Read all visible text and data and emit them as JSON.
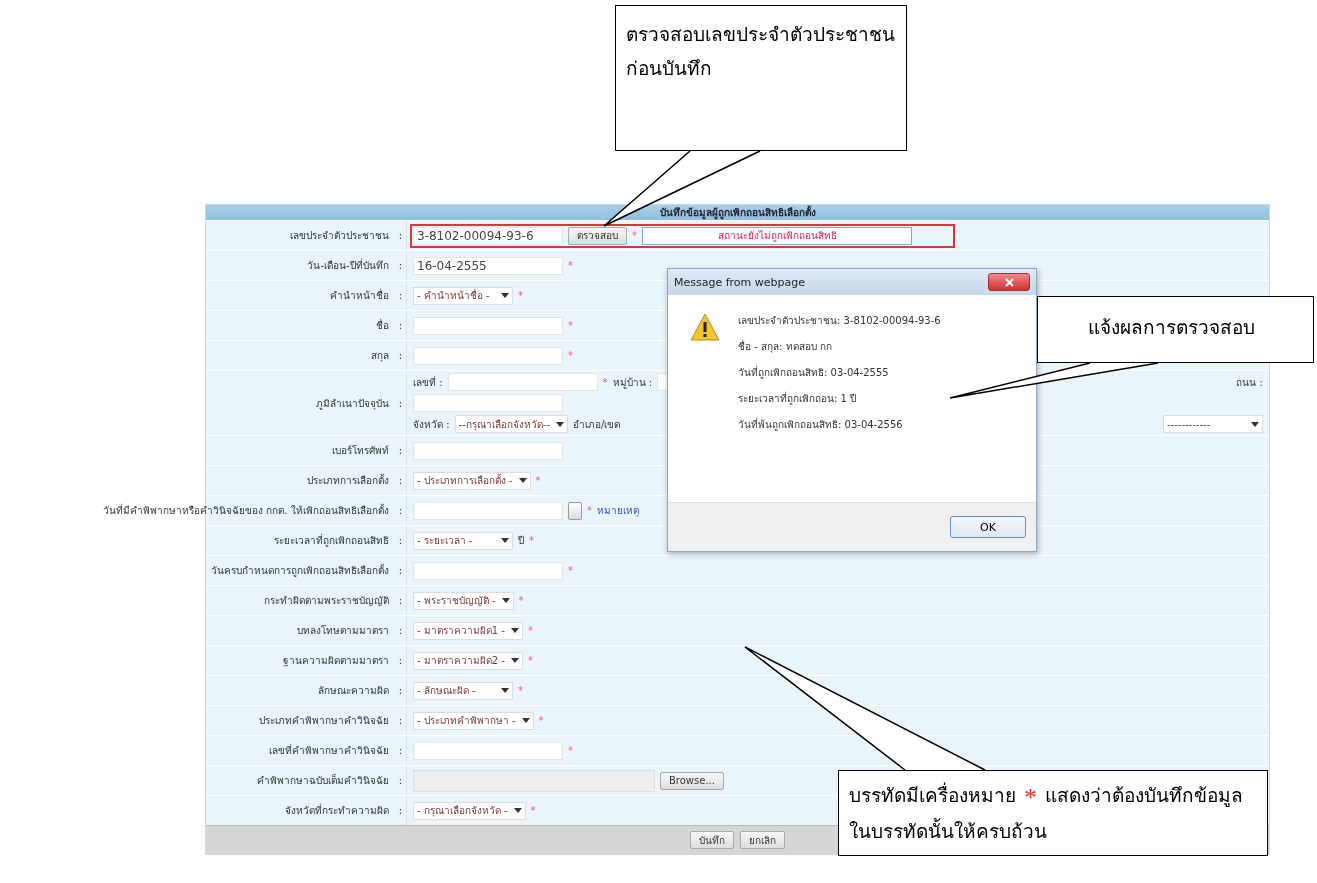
{
  "callouts": [
    {
      "lines": [
        [
          {
            "kind": "plain",
            "text": "ตรวจสอบเลขประจำตัวประชาชน"
          }
        ],
        [
          {
            "kind": "plain",
            "text": "ก่อนบันทึก"
          }
        ]
      ]
    },
    {
      "lines": [
        [
          {
            "kind": "plain",
            "text": "แจ้งผลการตรวจสอบ"
          }
        ]
      ]
    },
    {
      "lines": [
        [
          {
            "kind": "plain",
            "text": "บรรทัดมีเครื่องหมาย"
          },
          {
            "kind": "mark",
            "text": "*"
          },
          {
            "kind": "plain",
            "text": "แสดงว่าต้องบันทึกข้อมูล"
          }
        ],
        [
          {
            "kind": "plain",
            "text": "ในบรรทัดนั้นให้ครบถ้วน"
          }
        ]
      ]
    }
  ],
  "form": {
    "title": "บันทึกข้อมูลผู้ถูกเพิกถอนสิทธิเลือกตั้ง",
    "rows": [
      {
        "label": "เลขประจำตัวประชาชน",
        "colon": ":",
        "highlighted": true,
        "lines": [
          [
            {
              "kind": "field",
              "value": "3-8102-00094-93-6"
            },
            {
              "kind": "button",
              "text": "ตรวจสอบ"
            },
            {
              "kind": "required",
              "text": "*"
            },
            {
              "kind": "status",
              "text": "สถานะยังไม่ถูกเพิกถอนสิทธิ"
            }
          ]
        ]
      },
      {
        "label": "วัน-เดือน-ปีที่บันทึก",
        "colon": ":",
        "highlighted": false,
        "lines": [
          [
            {
              "kind": "field",
              "value": "16-04-2555"
            },
            {
              "kind": "required",
              "text": "*"
            }
          ]
        ]
      },
      {
        "label": "คำนำหน้าชื่อ",
        "colon": ":",
        "highlighted": false,
        "lines": [
          [
            {
              "kind": "select",
              "value": "- คำนำหน้าชื่อ -"
            },
            {
              "kind": "required",
              "text": "*"
            }
          ]
        ]
      },
      {
        "label": "ชื่อ",
        "colon": ":",
        "highlighted": false,
        "lines": [
          [
            {
              "kind": "field"
            },
            {
              "kind": "required",
              "text": "*"
            }
          ]
        ]
      },
      {
        "label": "สกุล",
        "colon": ":",
        "highlighted": false,
        "lines": [
          [
            {
              "kind": "field"
            },
            {
              "kind": "required",
              "text": "*"
            }
          ]
        ]
      },
      {
        "label": "ภูมิลำเนาปัจจุบัน",
        "colon": ":",
        "highlighted": false,
        "lines": [
          [
            {
              "kind": "text",
              "text": "เลขที่ :"
            },
            {
              "kind": "field"
            },
            {
              "kind": "required",
              "text": "*"
            },
            {
              "kind": "text",
              "text": "หมู่บ้าน :"
            },
            {
              "kind": "field"
            },
            {
              "kind": "spacer"
            },
            {
              "kind": "text",
              "text": "ถนน :"
            }
          ],
          [
            {
              "kind": "field"
            }
          ],
          [
            {
              "kind": "text",
              "text": "จังหวัด :"
            },
            {
              "kind": "select",
              "value": "--กรุณาเลือกจังหวัด--"
            },
            {
              "kind": "text",
              "text": "อำเภอ/เขต"
            },
            {
              "kind": "spacer"
            },
            {
              "kind": "select",
              "value": "------------"
            }
          ]
        ]
      },
      {
        "label": "เบอร์โทรศัพท์",
        "colon": ":",
        "highlighted": false,
        "lines": [
          [
            {
              "kind": "field"
            }
          ]
        ]
      },
      {
        "label": "ประเภทการเลือกตั้ง",
        "colon": ":",
        "highlighted": false,
        "lines": [
          [
            {
              "kind": "select",
              "value": "- ประเภทการเลือกตั้ง -"
            },
            {
              "kind": "required",
              "text": "*"
            }
          ]
        ]
      },
      {
        "label": "วันที่มีคำพิพากษาหรือคำวินิจฉัยของ กกต. ให้เพิกถอนสิทธิเลือกตั้ง",
        "colon": ":",
        "highlighted": false,
        "lines": [
          [
            {
              "kind": "field"
            },
            {
              "kind": "calendar"
            },
            {
              "kind": "required",
              "text": "*"
            },
            {
              "kind": "link",
              "text": "หมายเหตุ"
            }
          ]
        ]
      },
      {
        "label": "ระยะเวลาที่ถูกเพิกถอนสิทธิ",
        "colon": ":",
        "highlighted": false,
        "lines": [
          [
            {
              "kind": "select",
              "value": "- ระยะเวลา -"
            },
            {
              "kind": "text",
              "text": "ปี"
            },
            {
              "kind": "required",
              "text": "*"
            }
          ]
        ]
      },
      {
        "label": "วันครบกำหนดการถูกเพิกถอนสิทธิเลือกตั้ง",
        "colon": ":",
        "highlighted": false,
        "lines": [
          [
            {
              "kind": "field"
            },
            {
              "kind": "required",
              "text": "*"
            }
          ]
        ]
      },
      {
        "label": "กระทำผิดตามพระราชบัญญัติ",
        "colon": ":",
        "highlighted": false,
        "lines": [
          [
            {
              "kind": "select",
              "value": "- พระราชบัญญัติ -"
            },
            {
              "kind": "required",
              "text": "*"
            }
          ]
        ]
      },
      {
        "label": "บทลงโทษตามมาตรา",
        "colon": ":",
        "highlighted": false,
        "lines": [
          [
            {
              "kind": "select",
              "value": "- มาตราความผิด1 -"
            },
            {
              "kind": "required",
              "text": "*"
            }
          ]
        ]
      },
      {
        "label": "ฐานความผิดตามมาตรา",
        "colon": ":",
        "highlighted": false,
        "lines": [
          [
            {
              "kind": "select",
              "value": "- มาตราความผิด2 -"
            },
            {
              "kind": "required",
              "text": "*"
            }
          ]
        ]
      },
      {
        "label": "ลักษณะความผิด",
        "colon": ":",
        "highlighted": false,
        "lines": [
          [
            {
              "kind": "select",
              "value": "- ลักษณะผิด -"
            },
            {
              "kind": "required",
              "text": "*"
            }
          ]
        ]
      },
      {
        "label": "ประเภทคำพิพากษาคำวินิจฉัย",
        "colon": ":",
        "highlighted": false,
        "lines": [
          [
            {
              "kind": "select",
              "value": "- ประเภทคำพิพากษา -"
            },
            {
              "kind": "required",
              "text": "*"
            }
          ]
        ]
      },
      {
        "label": "เลขที่คำพิพากษาคำวินิจฉัย",
        "colon": ":",
        "highlighted": false,
        "lines": [
          [
            {
              "kind": "field"
            },
            {
              "kind": "required",
              "text": "*"
            }
          ]
        ]
      },
      {
        "label": "คำพิพากษาฉบับเต็มคำวินิจฉัย",
        "colon": ":",
        "highlighted": false,
        "lines": [
          [
            {
              "kind": "file",
              "text": "Browse..."
            }
          ]
        ]
      },
      {
        "label": "จังหวัดที่กระทำความผิด",
        "colon": ":",
        "highlighted": false,
        "lines": [
          [
            {
              "kind": "select",
              "value": "- กรุณาเลือกจังหวัด -"
            },
            {
              "kind": "required",
              "text": "*"
            }
          ]
        ]
      }
    ],
    "buttons": [
      "บันทึก",
      "ยกเลิก"
    ]
  },
  "dialog": {
    "title": "Message from webpage",
    "message_lines": [
      "เลขประจำตัวประชาชน: 3-8102-00094-93-6",
      "ชื่อ - สกุล: ทดสอบ กก",
      "วันที่ถูกเพิกถอนสิทธิ: 03-04-2555",
      "ระยะเวลาที่ถูกเพิกถอน: 1 ปี",
      "วันที่พ้นถูกเพิกถอนสิทธิ: 03-04-2556"
    ],
    "button": "OK"
  }
}
